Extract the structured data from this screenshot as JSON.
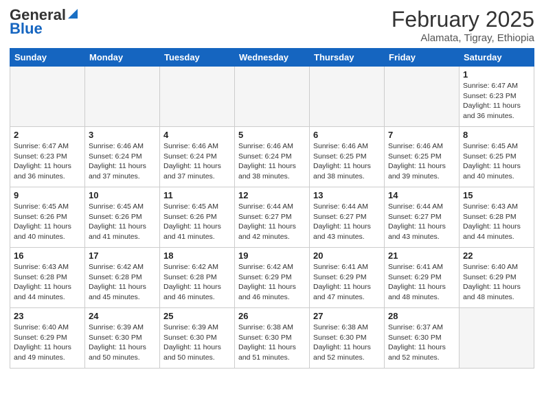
{
  "logo": {
    "general": "General",
    "blue": "Blue"
  },
  "title": "February 2025",
  "subtitle": "Alamata, Tigray, Ethiopia",
  "days_of_week": [
    "Sunday",
    "Monday",
    "Tuesday",
    "Wednesday",
    "Thursday",
    "Friday",
    "Saturday"
  ],
  "weeks": [
    [
      {
        "day": "",
        "info": ""
      },
      {
        "day": "",
        "info": ""
      },
      {
        "day": "",
        "info": ""
      },
      {
        "day": "",
        "info": ""
      },
      {
        "day": "",
        "info": ""
      },
      {
        "day": "",
        "info": ""
      },
      {
        "day": "1",
        "info": "Sunrise: 6:47 AM\nSunset: 6:23 PM\nDaylight: 11 hours\nand 36 minutes."
      }
    ],
    [
      {
        "day": "2",
        "info": "Sunrise: 6:47 AM\nSunset: 6:23 PM\nDaylight: 11 hours\nand 36 minutes."
      },
      {
        "day": "3",
        "info": "Sunrise: 6:46 AM\nSunset: 6:24 PM\nDaylight: 11 hours\nand 37 minutes."
      },
      {
        "day": "4",
        "info": "Sunrise: 6:46 AM\nSunset: 6:24 PM\nDaylight: 11 hours\nand 37 minutes."
      },
      {
        "day": "5",
        "info": "Sunrise: 6:46 AM\nSunset: 6:24 PM\nDaylight: 11 hours\nand 38 minutes."
      },
      {
        "day": "6",
        "info": "Sunrise: 6:46 AM\nSunset: 6:25 PM\nDaylight: 11 hours\nand 38 minutes."
      },
      {
        "day": "7",
        "info": "Sunrise: 6:46 AM\nSunset: 6:25 PM\nDaylight: 11 hours\nand 39 minutes."
      },
      {
        "day": "8",
        "info": "Sunrise: 6:45 AM\nSunset: 6:25 PM\nDaylight: 11 hours\nand 40 minutes."
      }
    ],
    [
      {
        "day": "9",
        "info": "Sunrise: 6:45 AM\nSunset: 6:26 PM\nDaylight: 11 hours\nand 40 minutes."
      },
      {
        "day": "10",
        "info": "Sunrise: 6:45 AM\nSunset: 6:26 PM\nDaylight: 11 hours\nand 41 minutes."
      },
      {
        "day": "11",
        "info": "Sunrise: 6:45 AM\nSunset: 6:26 PM\nDaylight: 11 hours\nand 41 minutes."
      },
      {
        "day": "12",
        "info": "Sunrise: 6:44 AM\nSunset: 6:27 PM\nDaylight: 11 hours\nand 42 minutes."
      },
      {
        "day": "13",
        "info": "Sunrise: 6:44 AM\nSunset: 6:27 PM\nDaylight: 11 hours\nand 43 minutes."
      },
      {
        "day": "14",
        "info": "Sunrise: 6:44 AM\nSunset: 6:27 PM\nDaylight: 11 hours\nand 43 minutes."
      },
      {
        "day": "15",
        "info": "Sunrise: 6:43 AM\nSunset: 6:28 PM\nDaylight: 11 hours\nand 44 minutes."
      }
    ],
    [
      {
        "day": "16",
        "info": "Sunrise: 6:43 AM\nSunset: 6:28 PM\nDaylight: 11 hours\nand 44 minutes."
      },
      {
        "day": "17",
        "info": "Sunrise: 6:42 AM\nSunset: 6:28 PM\nDaylight: 11 hours\nand 45 minutes."
      },
      {
        "day": "18",
        "info": "Sunrise: 6:42 AM\nSunset: 6:28 PM\nDaylight: 11 hours\nand 46 minutes."
      },
      {
        "day": "19",
        "info": "Sunrise: 6:42 AM\nSunset: 6:29 PM\nDaylight: 11 hours\nand 46 minutes."
      },
      {
        "day": "20",
        "info": "Sunrise: 6:41 AM\nSunset: 6:29 PM\nDaylight: 11 hours\nand 47 minutes."
      },
      {
        "day": "21",
        "info": "Sunrise: 6:41 AM\nSunset: 6:29 PM\nDaylight: 11 hours\nand 48 minutes."
      },
      {
        "day": "22",
        "info": "Sunrise: 6:40 AM\nSunset: 6:29 PM\nDaylight: 11 hours\nand 48 minutes."
      }
    ],
    [
      {
        "day": "23",
        "info": "Sunrise: 6:40 AM\nSunset: 6:29 PM\nDaylight: 11 hours\nand 49 minutes."
      },
      {
        "day": "24",
        "info": "Sunrise: 6:39 AM\nSunset: 6:30 PM\nDaylight: 11 hours\nand 50 minutes."
      },
      {
        "day": "25",
        "info": "Sunrise: 6:39 AM\nSunset: 6:30 PM\nDaylight: 11 hours\nand 50 minutes."
      },
      {
        "day": "26",
        "info": "Sunrise: 6:38 AM\nSunset: 6:30 PM\nDaylight: 11 hours\nand 51 minutes."
      },
      {
        "day": "27",
        "info": "Sunrise: 6:38 AM\nSunset: 6:30 PM\nDaylight: 11 hours\nand 52 minutes."
      },
      {
        "day": "28",
        "info": "Sunrise: 6:37 AM\nSunset: 6:30 PM\nDaylight: 11 hours\nand 52 minutes."
      },
      {
        "day": "",
        "info": ""
      }
    ]
  ]
}
